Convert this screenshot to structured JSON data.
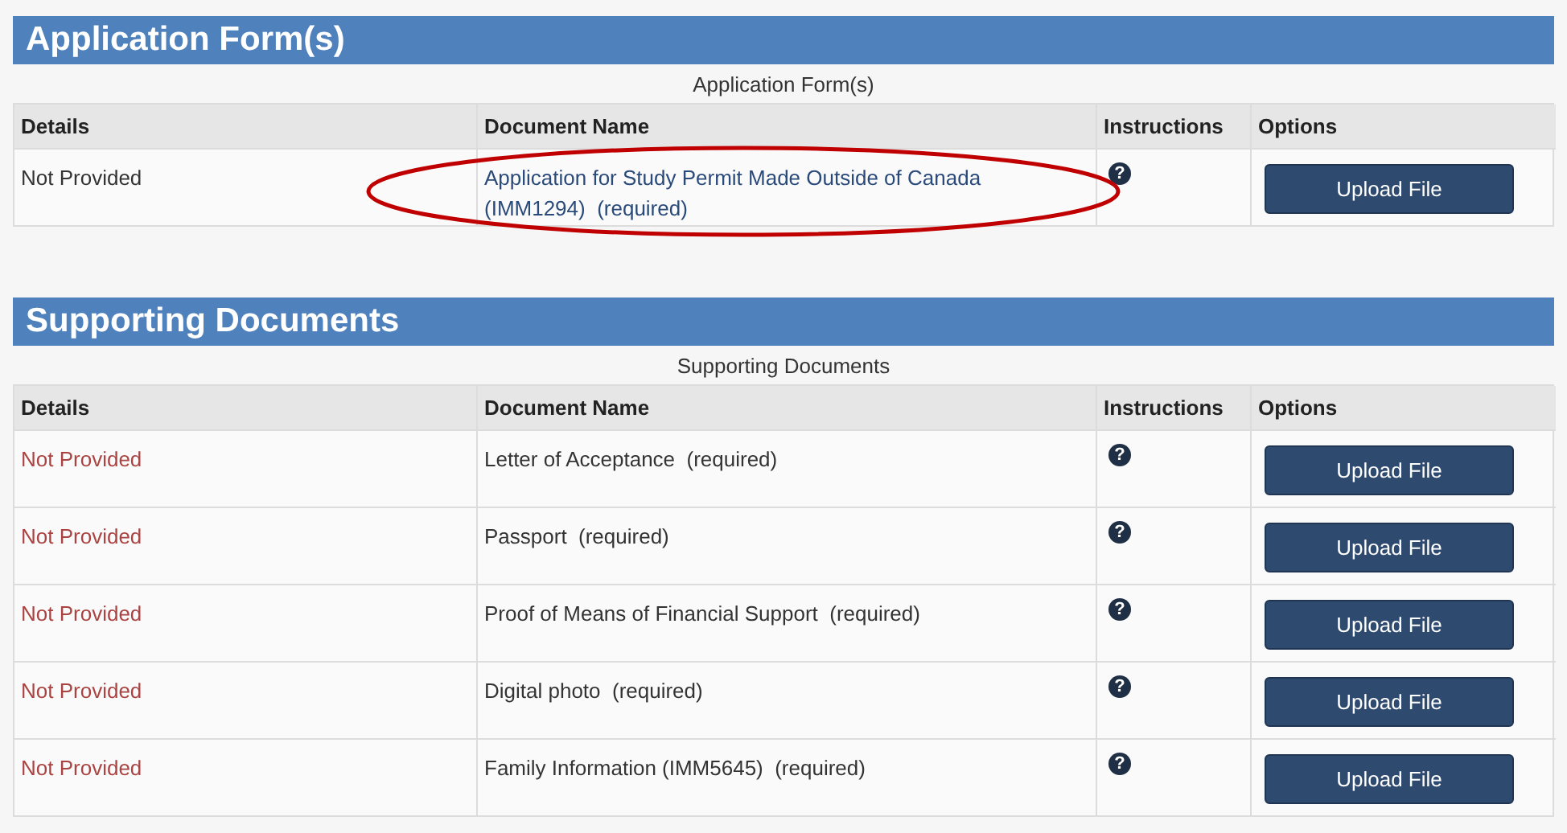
{
  "sections": [
    {
      "title": "Application Form(s)",
      "caption": "Application Form(s)",
      "columns": [
        "Details",
        "Document Name",
        "Instructions",
        "Options"
      ],
      "rows": [
        {
          "status": "Not Provided",
          "color": "#333333",
          "document": "Application for Study Permit Made Outside of Canada (IMM1294)  (required)",
          "kind": "link",
          "instructions": "?",
          "button": "Upload File",
          "circled": true
        }
      ]
    },
    {
      "title": "Supporting Documents",
      "caption": "Supporting Documents",
      "columns": [
        "Details",
        "Document Name",
        "Instructions",
        "Options"
      ],
      "rows": [
        {
          "status": "Not Provided",
          "color": "#a94442",
          "document": "Letter of Acceptance  (required)",
          "kind": "plain",
          "instructions": "?",
          "button": "Upload File"
        },
        {
          "status": "Not Provided",
          "color": "#a94442",
          "document": "Passport  (required)",
          "kind": "plain",
          "instructions": "?",
          "button": "Upload File"
        },
        {
          "status": "Not Provided",
          "color": "#a94442",
          "document": "Proof of Means of Financial Support  (required)",
          "kind": "plain",
          "instructions": "?",
          "button": "Upload File"
        },
        {
          "status": "Not Provided",
          "color": "#a94442",
          "document": "Digital photo  (required)",
          "kind": "plain",
          "instructions": "?",
          "button": "Upload File"
        },
        {
          "status": "Not Provided",
          "color": "#a94442",
          "document": "Family Information (IMM5645)  (required)",
          "kind": "plain",
          "instructions": "?",
          "button": "Upload File"
        }
      ]
    }
  ]
}
